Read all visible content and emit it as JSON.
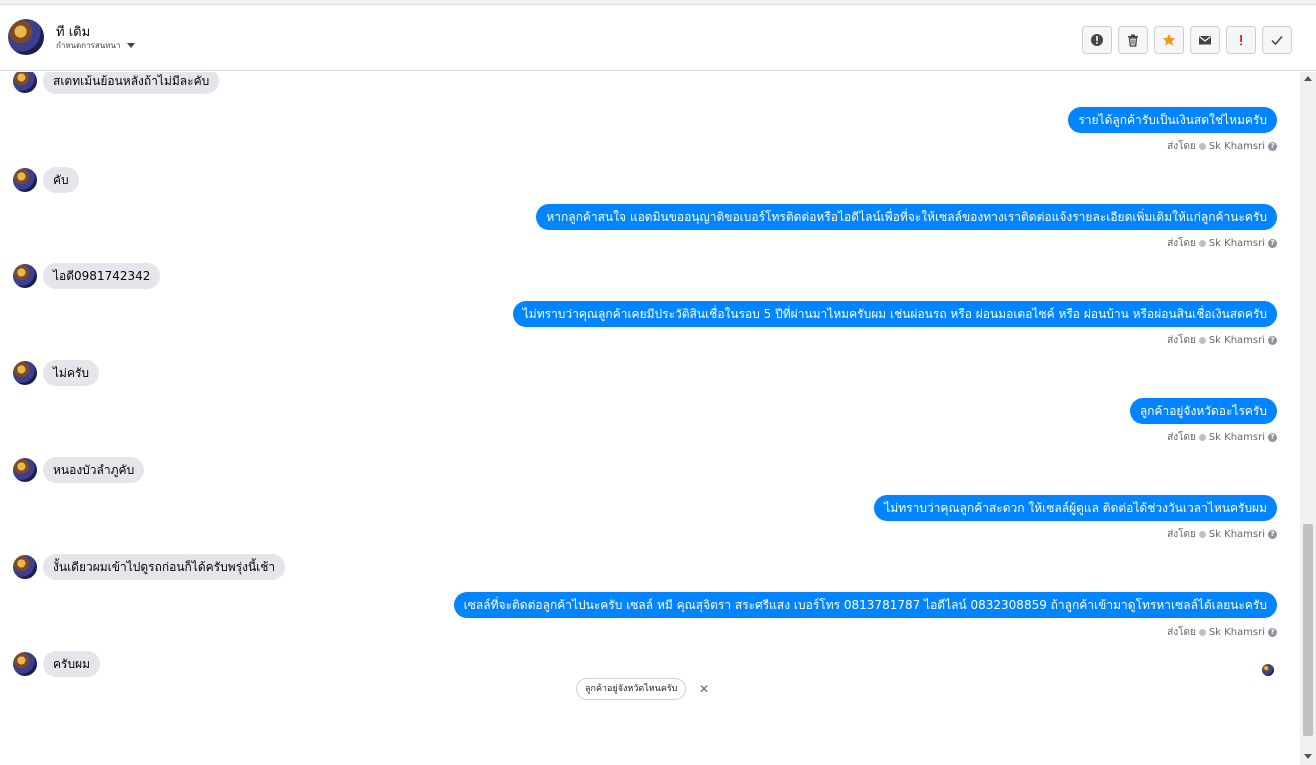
{
  "header": {
    "contact_name": "ที เดิม",
    "conversation_menu_label": "กำหนดการสนทนา",
    "actions": [
      {
        "name": "report-spam-button",
        "icon": "exclamation-circle-icon"
      },
      {
        "name": "delete-button",
        "icon": "trash-icon"
      },
      {
        "name": "star-button",
        "icon": "star-icon",
        "color": "#f7931e"
      },
      {
        "name": "mark-unread-button",
        "icon": "envelope-icon"
      },
      {
        "name": "follow-up-button",
        "icon": "exclamation-icon",
        "color": "#e02020"
      },
      {
        "name": "mark-done-button",
        "icon": "checkmark-icon"
      }
    ]
  },
  "messages": [
    {
      "dir": "in",
      "text": "สเตทเม้นย้อนหลังถ้าไม่มีละคับ"
    },
    {
      "dir": "out",
      "text": "รายได้ลูกค้ารับเป็นเงินสดใช่ไหมครับ",
      "sent_by_label": "ส่งโดย",
      "sender": "Sk Khamsri"
    },
    {
      "dir": "in",
      "text": "คับ"
    },
    {
      "dir": "out",
      "text": "หากลูกค้าสนใจ แอดมินขออนุญาติขอเบอร์โทรติดต่อหรือไอดีไลน์เพื่อที่จะให้เซลล์ของทางเราติดต่อแจ้งรายละเอียดเพิ่มเติมให้แก่ลูกค้านะครับ",
      "sent_by_label": "ส่งโดย",
      "sender": "Sk Khamsri"
    },
    {
      "dir": "in",
      "text": "ไอดี0981742342"
    },
    {
      "dir": "out",
      "text": "ไม่ทราบว่าคุณลูกค้าเคยมีประวัติสินเชื่อในรอบ 5 ปีที่ผ่านมาไหมครับผม เช่นผ่อนรถ หรือ ผ่อนมอเตอไซค์ หรือ ผ่อนบ้าน หรือผ่อนสินเชื่อเงินสดครับ",
      "sent_by_label": "ส่งโดย",
      "sender": "Sk Khamsri"
    },
    {
      "dir": "in",
      "text": "ไม่ครับ"
    },
    {
      "dir": "out",
      "text": "ลูกค้าอยู่จังหวัดอะไรครับ",
      "sent_by_label": "ส่งโดย",
      "sender": "Sk Khamsri"
    },
    {
      "dir": "in",
      "text": "หนองบัวลำภูคับ"
    },
    {
      "dir": "out",
      "text": "ไม่ทราบว่าคุณลูกค้าสะดวก ให้เซลล์ผู้ดูแล ติดต่อได้ช่วงวันเวลาไหนครับผม",
      "sent_by_label": "ส่งโดย",
      "sender": "Sk Khamsri"
    },
    {
      "dir": "in",
      "text": "งั้นเดียวผมเข้าไปดูรถก่อนก็ได้ครับพรุ่งนี้เช้า"
    },
    {
      "dir": "out",
      "text": "เซลล์ที่จะติดต่อลูกค้าไปนะครับ เซลล์ หมี คุณสุจิตรา สระศรีแสง เบอร์โทร 0813781787 ไอดีไลน์ 0832308859 ถ้าลูกค้าเข้ามาดูโทรหาเซลล์ได้เลยนะครับ",
      "sent_by_label": "ส่งโดย",
      "sender": "Sk Khamsri"
    },
    {
      "dir": "in",
      "text": "ครับผม"
    }
  ],
  "suggested_reply": {
    "text": "ลูกค้าอยู่จังหวัดไหนครับ",
    "close_icon": "close-icon"
  },
  "colors": {
    "outgoing_bubble": "#0084ff",
    "incoming_bubble": "#e4e6eb"
  }
}
